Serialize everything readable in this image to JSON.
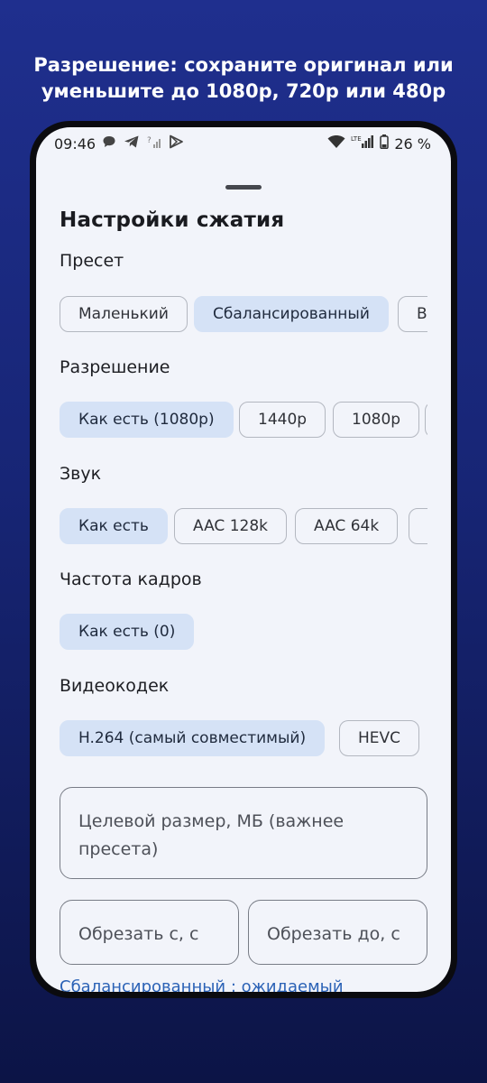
{
  "headline": {
    "line1": "Разрешение: сохраните оригинал или",
    "line2": "уменьшите до 1080p, 720p или 480p"
  },
  "status_bar": {
    "time": "09:46",
    "battery": "26 %",
    "network": "LTE"
  },
  "sheet": {
    "title": "Настройки сжатия",
    "preset": {
      "label": "Пресет",
      "options": [
        "Маленький",
        "Сбалансированный",
        "В"
      ],
      "selected": "Сбалансированный"
    },
    "resolution": {
      "label": "Разрешение",
      "options": [
        "Как есть (1080p)",
        "1440p",
        "1080p"
      ],
      "selected": "Как есть (1080p)"
    },
    "audio": {
      "label": "Звук",
      "options": [
        "Как есть",
        "AAC 128k",
        "AAC 64k"
      ],
      "selected": "Как есть"
    },
    "framerate": {
      "label": "Частота кадров",
      "options": [
        "Как есть (0)"
      ],
      "selected": "Как есть (0)"
    },
    "codec": {
      "label": "Видеокодек",
      "options": [
        "H.264 (самый совместимый)",
        "HEVC"
      ],
      "selected": "H.264 (самый совместимый)"
    },
    "target_size_placeholder": "Целевой размер, МБ (важнее пресета)",
    "trim_from_placeholder": "Обрезать с, с",
    "trim_to_placeholder": "Обрезать до, с",
    "summary": "Сбалансированный : ожидаемый"
  },
  "colors": {
    "background_top": "#1f2f8e",
    "background_bottom": "#0c1446",
    "sheet_bg": "#f2f4fa",
    "chip_selected": "#d5e2f6",
    "link_text": "#2b62b6"
  },
  "icons": [
    "message-icon",
    "telegram-icon",
    "wifi-calling-icon",
    "play-store-icon",
    "wifi-icon",
    "signal-icon",
    "battery-icon"
  ]
}
